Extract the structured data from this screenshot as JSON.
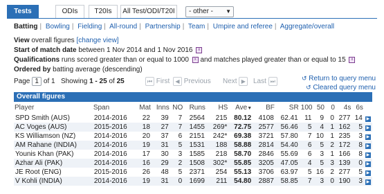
{
  "tabs": [
    "Tests",
    "ODIs",
    "T20Is",
    "All Test/ODI/T20I"
  ],
  "format_select": {
    "value": "- other -"
  },
  "nav": [
    "Batting",
    "Bowling",
    "Fielding",
    "All-round",
    "Partnership",
    "Team",
    "Umpire and referee",
    "Aggregate/overall"
  ],
  "info": {
    "view_prefix": "View",
    "view_value": "overall figures",
    "change_view": "[change view]",
    "start_label": "Start of match date",
    "start_text": "between 1 Nov 2014 and 1 Nov 2016",
    "qual_label": "Qualifications",
    "qual_text1": "runs scored greater than or equal to 1000",
    "qual_text2": "and matches played greater than or equal to 15",
    "order_label": "Ordered by",
    "order_text": "batting average (descending)"
  },
  "pager": {
    "page_label": "Page",
    "page_current": "1",
    "page_of": "of 1",
    "showing": "Showing",
    "range": "1 - 25",
    "of": "of",
    "total": "25",
    "first": "First",
    "previous": "Previous",
    "next": "Next",
    "last": "Last"
  },
  "returns": [
    "Return to query menu",
    "Cleared query menu"
  ],
  "table": {
    "title": "Overall figures",
    "headers": [
      "Player",
      "Span",
      "Mat",
      "Inns",
      "NO",
      "Runs",
      "HS",
      "Ave",
      "BF",
      "SR",
      "100",
      "50",
      "0",
      "4s",
      "6s"
    ],
    "rows": [
      [
        "SPD Smith (AUS)",
        "2014-2016",
        "22",
        "39",
        "7",
        "2564",
        "215",
        "80.12",
        "4108",
        "62.41",
        "11",
        "9",
        "0",
        "277",
        "14"
      ],
      [
        "AC Voges (AUS)",
        "2015-2016",
        "18",
        "27",
        "7",
        "1455",
        "269*",
        "72.75",
        "2577",
        "56.46",
        "5",
        "4",
        "1",
        "162",
        "5"
      ],
      [
        "KS Williamson (NZ)",
        "2014-2016",
        "20",
        "37",
        "6",
        "2151",
        "242*",
        "69.38",
        "3721",
        "57.80",
        "7",
        "10",
        "1",
        "235",
        "3"
      ],
      [
        "AM Rahane (INDIA)",
        "2014-2016",
        "19",
        "31",
        "5",
        "1531",
        "188",
        "58.88",
        "2814",
        "54.40",
        "6",
        "5",
        "2",
        "172",
        "8"
      ],
      [
        "Younis Khan (PAK)",
        "2014-2016",
        "17",
        "30",
        "3",
        "1585",
        "218",
        "58.70",
        "2846",
        "55.69",
        "6",
        "3",
        "1",
        "166",
        "8"
      ],
      [
        "Azhar Ali (PAK)",
        "2014-2016",
        "16",
        "29",
        "2",
        "1508",
        "302*",
        "55.85",
        "3205",
        "47.05",
        "4",
        "5",
        "3",
        "139",
        "0"
      ],
      [
        "JE Root (ENG)",
        "2015-2016",
        "26",
        "48",
        "5",
        "2371",
        "254",
        "55.13",
        "3706",
        "63.97",
        "5",
        "16",
        "2",
        "277",
        "5"
      ],
      [
        "V Kohli (INDIA)",
        "2014-2016",
        "19",
        "31",
        "0",
        "1699",
        "211",
        "54.80",
        "2887",
        "58.85",
        "7",
        "3",
        "0",
        "190",
        "3"
      ]
    ]
  }
}
